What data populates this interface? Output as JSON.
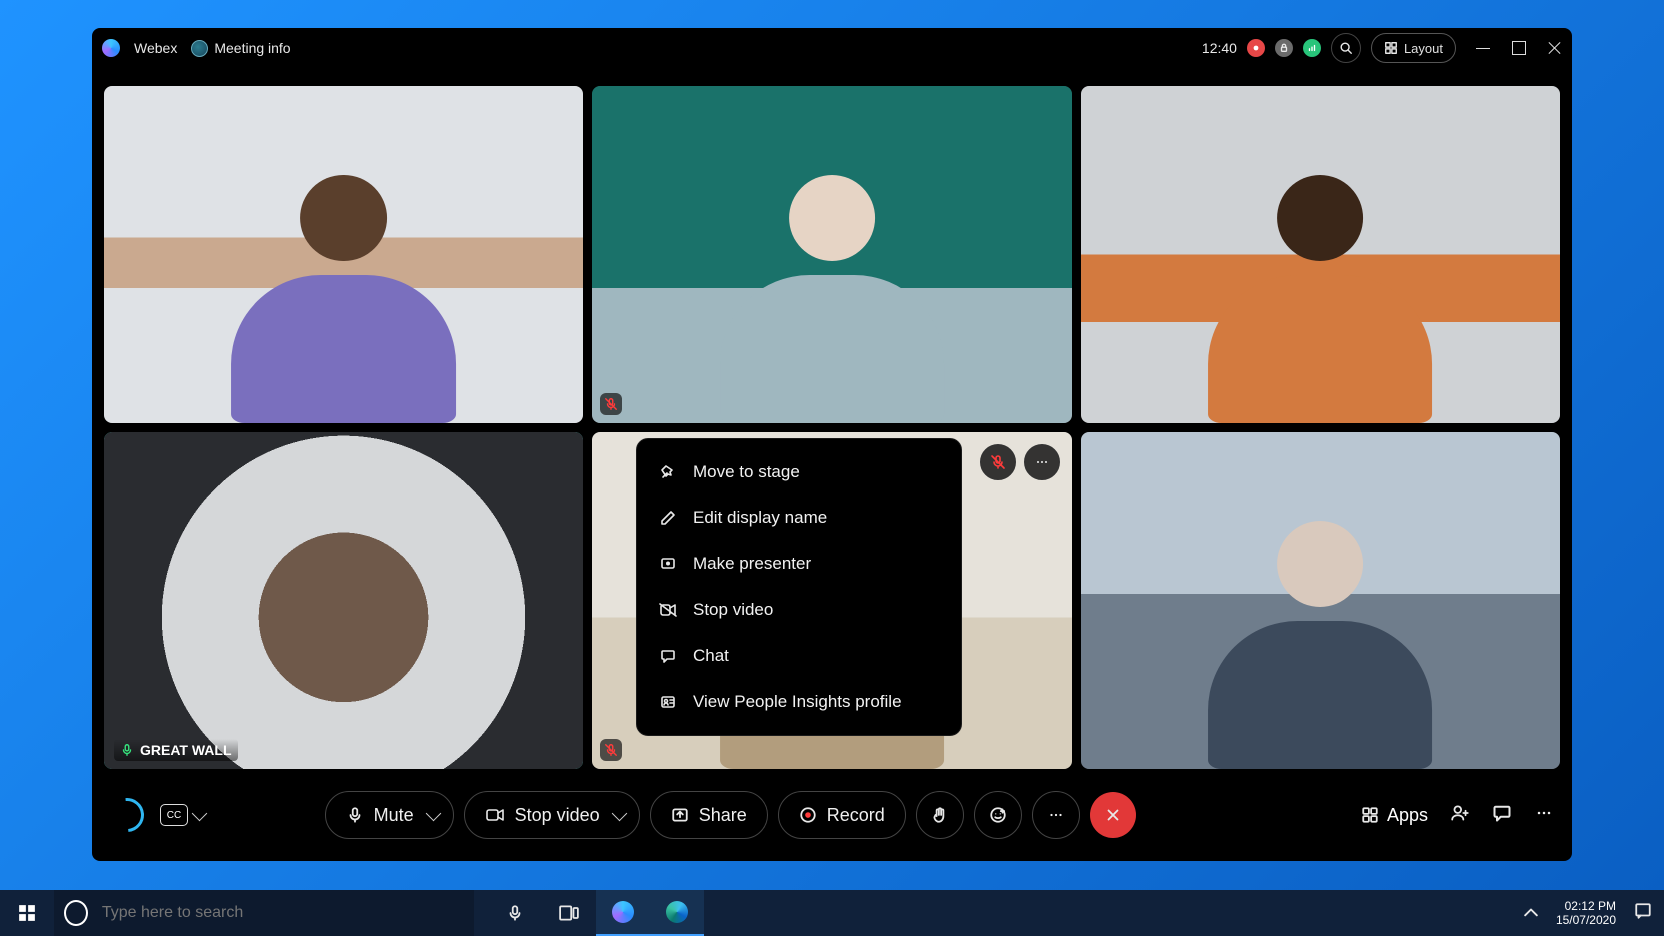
{
  "title_bar": {
    "app_name": "Webex",
    "meeting_info_label": "Meeting info",
    "clock": "12:40",
    "layout_label": "Layout"
  },
  "participants": [
    {
      "muted": false,
      "selected": false,
      "label": ""
    },
    {
      "muted": true,
      "selected": false,
      "label": ""
    },
    {
      "muted": false,
      "selected": false,
      "label": ""
    },
    {
      "muted": false,
      "selected": true,
      "label": "GREAT WALL"
    },
    {
      "muted": true,
      "selected": false,
      "label": ""
    },
    {
      "muted": false,
      "selected": false,
      "label": ""
    }
  ],
  "context_menu": {
    "items": [
      "Move to stage",
      "Edit display name",
      "Make presenter",
      "Stop video",
      "Chat",
      "View People Insights profile"
    ]
  },
  "bottom_bar": {
    "mute": "Mute",
    "stop_video": "Stop video",
    "share": "Share",
    "record": "Record",
    "apps": "Apps"
  },
  "taskbar": {
    "search_placeholder": "Type here to search",
    "time": "02:12 PM",
    "date": "15/07/2020"
  }
}
